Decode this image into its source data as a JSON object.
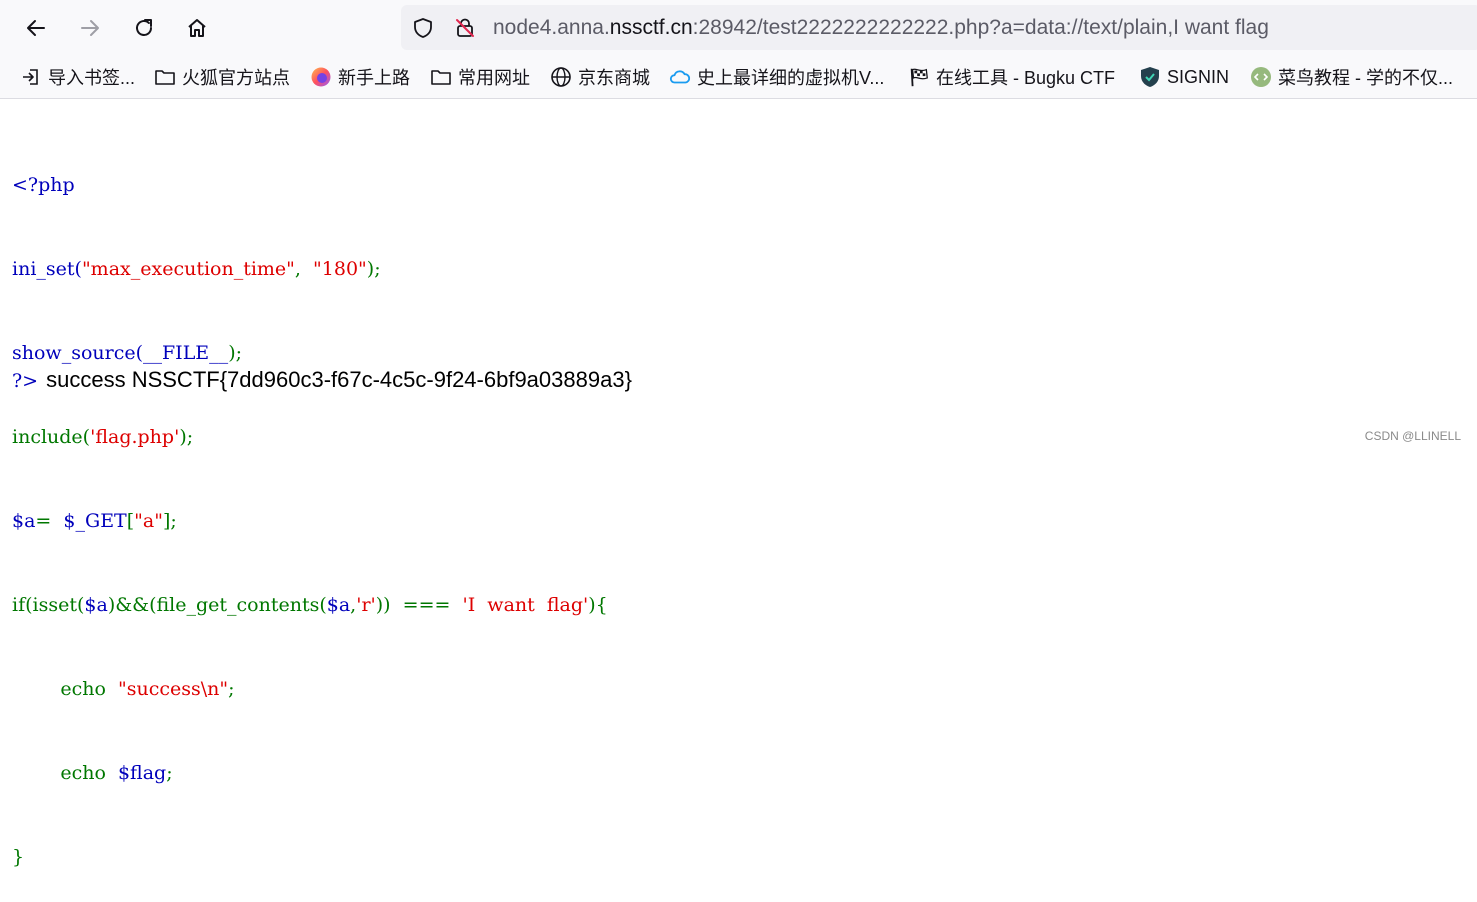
{
  "browser": {
    "url": {
      "host": "node4.anna.",
      "domain": "nssctf.cn",
      "rest": ":28942/test2222222222222.php?a=data://text/plain,I want flag"
    }
  },
  "bookmarks": [
    {
      "label": "导入书签...",
      "icon": "import-icon"
    },
    {
      "label": "火狐官方站点",
      "icon": "folder-icon"
    },
    {
      "label": "新手上路",
      "icon": "firefox-icon"
    },
    {
      "label": "常用网址",
      "icon": "folder-icon"
    },
    {
      "label": "京东商城",
      "icon": "globe-icon"
    },
    {
      "label": "史上最详细的虚拟机V...",
      "icon": "cloud-icon"
    },
    {
      "label": "在线工具 - Bugku CTF",
      "icon": "checkered-flag-icon"
    },
    {
      "label": "SIGNIN",
      "icon": "shield-icon"
    },
    {
      "label": "菜鸟教程 - 学的不仅...",
      "icon": "runoob-icon"
    }
  ],
  "code": {
    "line1": "<?php",
    "line2": {
      "fn": "ini_set(",
      "s1": "\"max_execution_time\"",
      "mid": ",  ",
      "s2": "\"180\"",
      "end": ");"
    },
    "line3": {
      "fn": "show_source(",
      "arg": "__FILE__",
      "end": ");"
    },
    "line4": {
      "kw": "include(",
      "s": "'flag.php'",
      "end": ");"
    },
    "line5": {
      "var": "$a",
      "op": "=  ",
      "get": "$_GET",
      "br": "[",
      "s": "\"a\"",
      "end": "];"
    },
    "line6": {
      "if": "if(isset(",
      "v1": "$a",
      "and": ")&&(file_get_contents(",
      "v2": "$a",
      "comma": ",",
      "s": "'r'",
      "cmp": "))  ===  ",
      "s2": "'I  want  flag'",
      "end": "){"
    },
    "line7": {
      "indent": "        ",
      "kw": "echo  ",
      "s": "\"success\\n\"",
      "end": ";"
    },
    "line8": {
      "indent": "        ",
      "kw": "echo  ",
      "v": "$flag",
      "end": ";"
    },
    "line9": "}",
    "close": "?>"
  },
  "output": "success NSSCTF{7dd960c3-f67c-4c5c-9f24-6bf9a03889a3}",
  "watermark": "CSDN @LLINELL",
  "colors": {
    "php_default": "#0000bb",
    "php_keyword": "#007700",
    "php_string": "#dd0000"
  }
}
